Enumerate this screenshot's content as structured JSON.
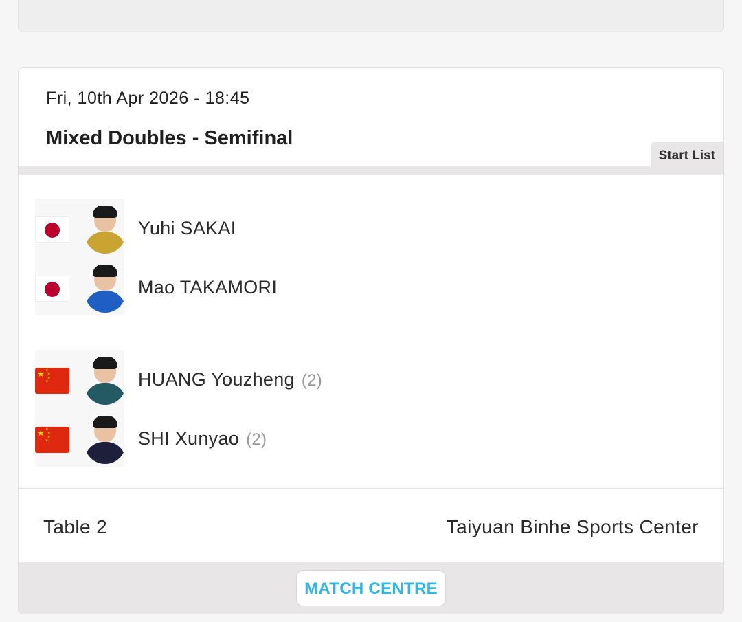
{
  "match": {
    "datetime": "Fri, 10th Apr 2026 - 18:45",
    "event": "Mixed Doubles - Semifinal",
    "start_list_label": "Start List"
  },
  "teams": [
    {
      "players": [
        {
          "name": "Yuhi SAKAI",
          "seed": "",
          "flag_icon": "japan-flag-icon",
          "shirt_color": "#c9a431"
        },
        {
          "name": "Mao TAKAMORI",
          "seed": "",
          "flag_icon": "japan-flag-icon",
          "shirt_color": "#1f5fc4"
        }
      ]
    },
    {
      "players": [
        {
          "name": "HUANG Youzheng",
          "seed": "(2)",
          "flag_icon": "china-flag-icon",
          "shirt_color": "#245a63"
        },
        {
          "name": "SHI Xunyao",
          "seed": "(2)",
          "flag_icon": "china-flag-icon",
          "shirt_color": "#1d1f3b"
        }
      ]
    }
  ],
  "footer": {
    "table": "Table 2",
    "venue": "Taiyuan Binhe Sports Center"
  },
  "actions": {
    "match_centre": "MATCH CENTRE"
  },
  "colors": {
    "accent": "#2fb6e6",
    "japan_red": "#bc002d",
    "china_red": "#de2910",
    "china_yellow": "#ffde00"
  }
}
